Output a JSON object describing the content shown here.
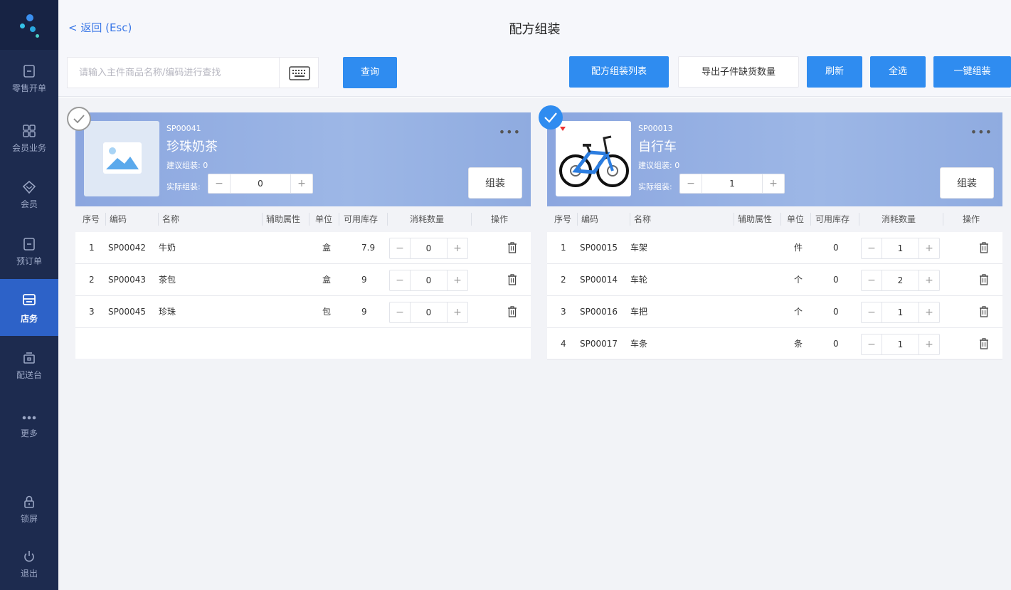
{
  "sidebar": {
    "items": [
      {
        "label": "零售开单",
        "icon": "receipt-icon",
        "active": false
      },
      {
        "label": "会员业务",
        "icon": "grid-icon",
        "active": false
      },
      {
        "label": "会员",
        "icon": "diamond-icon",
        "active": false
      },
      {
        "label": "预订单",
        "icon": "receipt-icon",
        "active": false
      },
      {
        "label": "店务",
        "icon": "store-icon",
        "active": true
      },
      {
        "label": "配送台",
        "icon": "delivery-icon",
        "active": false
      },
      {
        "label": "更多",
        "icon": "more-dots-icon",
        "active": false
      },
      {
        "label": "锁屏",
        "icon": "lock-icon",
        "active": false
      },
      {
        "label": "退出",
        "icon": "power-icon",
        "active": false
      }
    ]
  },
  "header": {
    "back_label": "< 返回 (Esc)",
    "title": "配方组装"
  },
  "toolbar": {
    "search_placeholder": "请输入主件商品名称/编码进行查找",
    "query_label": "查询",
    "list_label": "配方组装列表",
    "export_label": "导出子件缺货数量",
    "refresh_label": "刷新",
    "select_all_label": "全选",
    "one_click_label": "一键组装"
  },
  "table_headers": {
    "index": "序号",
    "code": "编码",
    "name": "名称",
    "attr": "辅助属性",
    "unit": "单位",
    "stock": "可用库存",
    "consume": "消耗数量",
    "action": "操作"
  },
  "cards": [
    {
      "selected": false,
      "code": "SP00041",
      "name": "珍珠奶茶",
      "suggest": "建议组装: 0",
      "actual_label": "实际组装:",
      "actual_value": "0",
      "assemble_label": "组装",
      "image": "placeholder-image-icon",
      "rows": [
        {
          "index": "1",
          "code": "SP00042",
          "name": "牛奶",
          "unit": "盒",
          "stock": "7.9",
          "qty": "0"
        },
        {
          "index": "2",
          "code": "SP00043",
          "name": "茶包",
          "unit": "盒",
          "stock": "9",
          "qty": "0"
        },
        {
          "index": "3",
          "code": "SP00045",
          "name": "珍珠",
          "unit": "包",
          "stock": "9",
          "qty": "0"
        }
      ]
    },
    {
      "selected": true,
      "code": "SP00013",
      "name": "自行车",
      "suggest": "建议组装: 0",
      "actual_label": "实际组装:",
      "actual_value": "1",
      "assemble_label": "组装",
      "image": "bicycle-image",
      "rows": [
        {
          "index": "1",
          "code": "SP00015",
          "name": "车架",
          "unit": "件",
          "stock": "0",
          "qty": "1"
        },
        {
          "index": "2",
          "code": "SP00014",
          "name": "车轮",
          "unit": "个",
          "stock": "0",
          "qty": "2"
        },
        {
          "index": "3",
          "code": "SP00016",
          "name": "车把",
          "unit": "个",
          "stock": "0",
          "qty": "1"
        },
        {
          "index": "4",
          "code": "SP00017",
          "name": "车条",
          "unit": "条",
          "stock": "0",
          "qty": "1"
        }
      ]
    }
  ],
  "colors": {
    "sidebar_bg": "#1d2b4f",
    "active_nav": "#2d62c8",
    "primary_button": "#2f8cf0",
    "card_header": "#8ba6df"
  }
}
